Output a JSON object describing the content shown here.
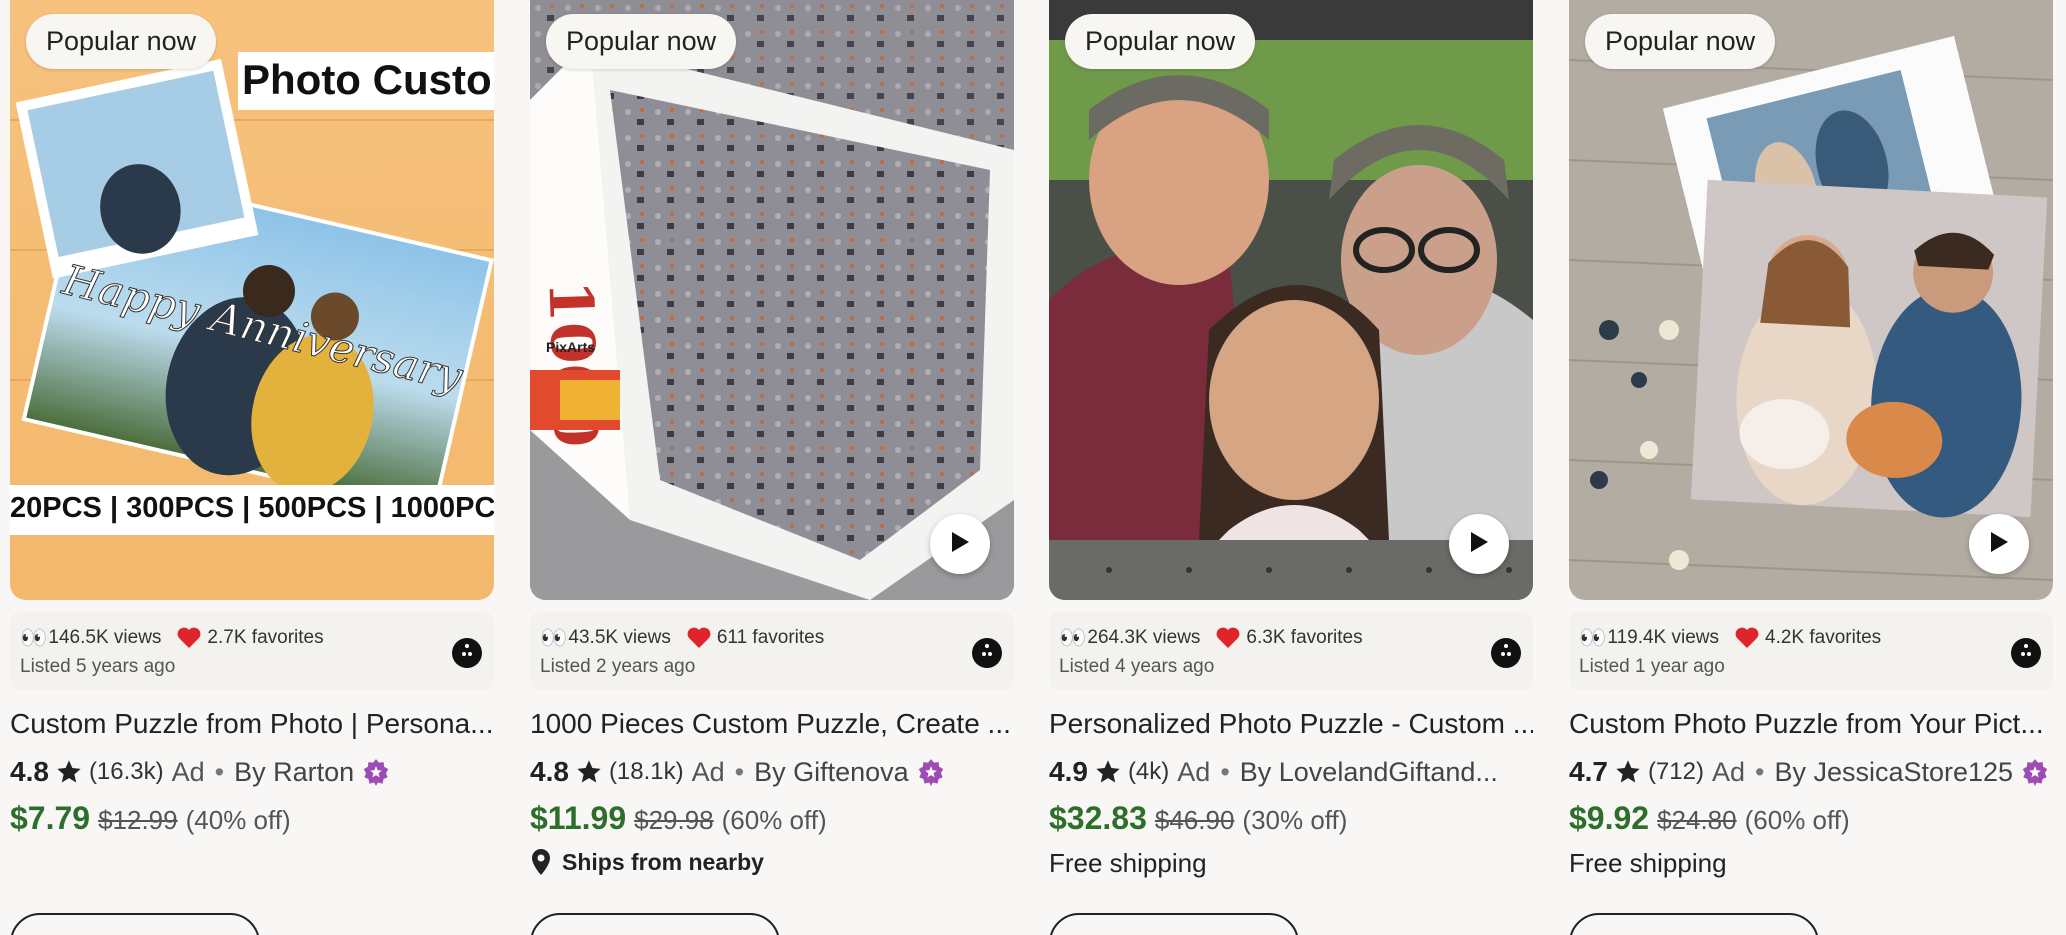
{
  "cards": [
    {
      "badge": "Popular now",
      "image_text_top": "Photo Custo",
      "image_text_band": "20PCS | 300PCS | 500PCS | 1000PC",
      "image_script_text": "Happy Anniversary",
      "views": "146.5K views",
      "favorites": "2.7K favorites",
      "listed": "Listed 5 years ago",
      "title": "Custom Puzzle from Photo | Persona...",
      "rating": "4.8",
      "reviews": "(16.3k)",
      "ad": "Ad",
      "seller": "By Rarton",
      "price": "$7.79",
      "original_price": "$12.99",
      "discount": "(40% off)",
      "extra": ""
    },
    {
      "badge": "Popular now",
      "image_text_top": "1000",
      "image_text_band": "PixArts",
      "views": "43.5K views",
      "favorites": "611 favorites",
      "listed": "Listed 2 years ago",
      "title": "1000 Pieces Custom Puzzle, Create ...",
      "rating": "4.8",
      "reviews": "(18.1k)",
      "ad": "Ad",
      "seller": "By Giftenova",
      "price": "$11.99",
      "original_price": "$29.98",
      "discount": "(60% off)",
      "extra": "Ships from nearby"
    },
    {
      "badge": "Popular now",
      "views": "264.3K views",
      "favorites": "6.3K favorites",
      "listed": "Listed 4 years ago",
      "title": "Personalized Photo Puzzle - Custom ...",
      "rating": "4.9",
      "reviews": "(4k)",
      "ad": "Ad",
      "seller": "By LovelandGiftand...",
      "price": "$32.83",
      "original_price": "$46.90",
      "discount": "(30% off)",
      "extra": "Free shipping"
    },
    {
      "badge": "Popular now",
      "views": "119.4K views",
      "favorites": "4.2K favorites",
      "listed": "Listed 1 year ago",
      "title": "Custom Photo Puzzle from Your Pict...",
      "rating": "4.7",
      "reviews": "(712)",
      "ad": "Ad",
      "seller": "By JessicaStore125",
      "price": "$9.92",
      "original_price": "$24.80",
      "discount": "(60% off)",
      "extra": "Free shipping"
    }
  ],
  "separator": "•",
  "colors": {
    "price": "#2d6f2a",
    "heart": "#e0242c",
    "star_seller": "#9d4bb5",
    "background": "#f8f7f5"
  },
  "icons": [
    "eyes-icon",
    "heart-icon",
    "star-icon",
    "star-seller-icon",
    "more-icon",
    "play-icon",
    "location-pin-icon"
  ]
}
